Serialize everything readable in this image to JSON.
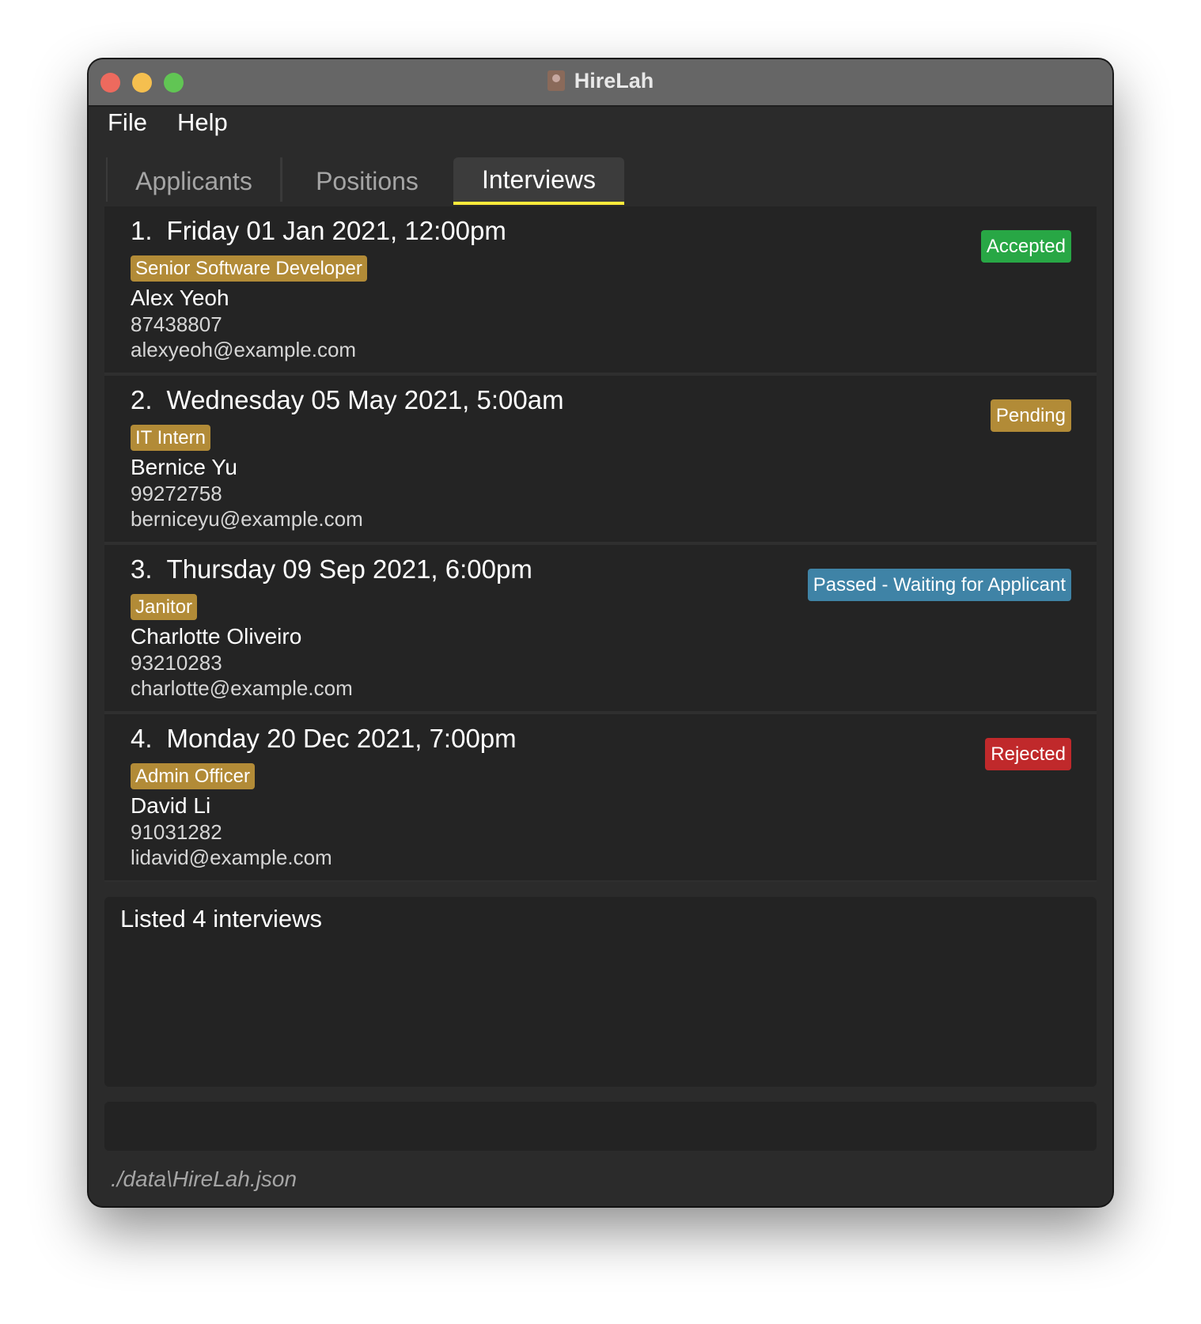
{
  "window": {
    "title": "HireLah"
  },
  "menu": {
    "file": "File",
    "help": "Help"
  },
  "tabs": [
    {
      "label": "Applicants",
      "selected": false
    },
    {
      "label": "Positions",
      "selected": false
    },
    {
      "label": "Interviews",
      "selected": true
    }
  ],
  "interviews": [
    {
      "index": "1.",
      "datetime": "Friday 01 Jan 2021, 12:00pm",
      "position": "Senior Software Developer",
      "name": "Alex Yeoh",
      "phone": "87438807",
      "email": "alexyeoh@example.com",
      "status": "Accepted",
      "status_color": "#28a745"
    },
    {
      "index": "2.",
      "datetime": "Wednesday 05 May 2021, 5:00am",
      "position": "IT Intern",
      "name": "Bernice Yu",
      "phone": "99272758",
      "email": "berniceyu@example.com",
      "status": "Pending",
      "status_color": "#b28b37"
    },
    {
      "index": "3.",
      "datetime": "Thursday 09 Sep 2021, 6:00pm",
      "position": "Janitor",
      "name": "Charlotte Oliveiro",
      "phone": "93210283",
      "email": "charlotte@example.com",
      "status": "Passed - Waiting for Applicant",
      "status_color": "#3f83a6"
    },
    {
      "index": "4.",
      "datetime": "Monday 20 Dec 2021, 7:00pm",
      "position": "Admin Officer",
      "name": "David Li",
      "phone": "91031282",
      "email": "lidavid@example.com",
      "status": "Rejected",
      "status_color": "#c0292b"
    }
  ],
  "result": {
    "message": "Listed 4 interviews"
  },
  "command": {
    "value": "",
    "placeholder": ""
  },
  "status_bar": {
    "file_path": "./data\\HireLah.json"
  },
  "colors": {
    "accent_tab_underline": "#ffeb3b",
    "position_tag": "#b28b37",
    "background": "#2b2b2b"
  }
}
